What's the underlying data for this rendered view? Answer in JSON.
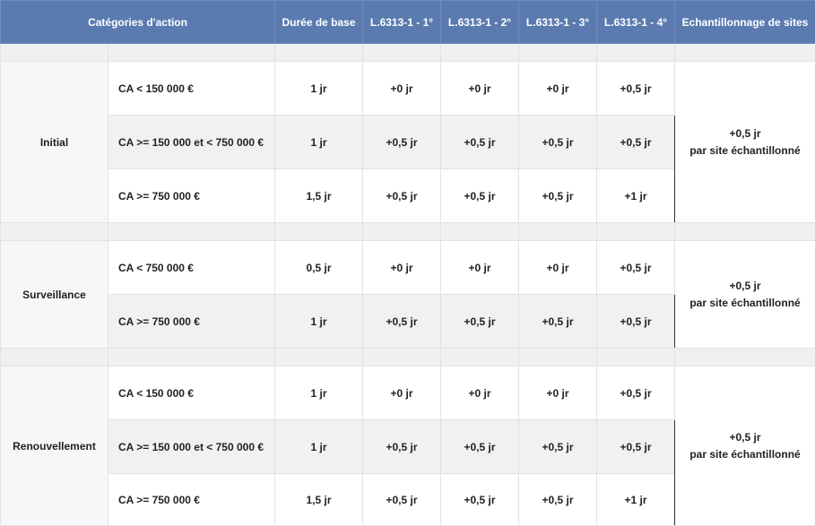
{
  "header": {
    "cols": [
      "Catégories d'action",
      "Durée de base",
      "L.6313-1 - 1°",
      "L.6313-1 - 2°",
      "L.6313-1 - 3°",
      "L.6313-1 - 4°",
      "Echantillonnage de sites"
    ]
  },
  "colors": {
    "header_bg": "#5b7bb0",
    "header_text": "#ffffff",
    "alt_row_bg": "#f1f1f1",
    "spacer_bg": "#f0f0f0"
  },
  "groups": [
    {
      "category": "Initial",
      "rows": [
        {
          "range": "CA < 150 000 €",
          "base": "1 jr",
          "c1": "+0 jr",
          "c2": "+0 jr",
          "c3": "+0 jr",
          "c4": "+0,5 jr"
        },
        {
          "range": "CA >= 150 000 et < 750 000 €",
          "base": "1 jr",
          "c1": "+0,5 jr",
          "c2": "+0,5 jr",
          "c3": "+0,5 jr",
          "c4": "+0,5 jr"
        },
        {
          "range": "CA >= 750 000 €",
          "base": "1,5 jr",
          "c1": "+0,5 jr",
          "c2": "+0,5 jr",
          "c3": "+0,5 jr",
          "c4": "+1 jr"
        }
      ],
      "sites_line1": "+0,5 jr",
      "sites_line2": "par site échantillonné"
    },
    {
      "category": "Surveillance",
      "rows": [
        {
          "range": "CA < 750 000 €",
          "base": "0,5 jr",
          "c1": "+0 jr",
          "c2": "+0 jr",
          "c3": "+0 jr",
          "c4": "+0,5 jr"
        },
        {
          "range": "CA >= 750 000 €",
          "base": "1 jr",
          "c1": "+0,5 jr",
          "c2": "+0,5 jr",
          "c3": "+0,5 jr",
          "c4": "+0,5 jr"
        }
      ],
      "sites_line1": "+0,5 jr",
      "sites_line2": "par site échantillonné"
    },
    {
      "category": "Renouvellement",
      "rows": [
        {
          "range": "CA < 150 000 €",
          "base": "1 jr",
          "c1": "+0 jr",
          "c2": "+0 jr",
          "c3": "+0 jr",
          "c4": "+0,5 jr"
        },
        {
          "range": "CA >= 150 000 et < 750 000 €",
          "base": "1 jr",
          "c1": "+0,5 jr",
          "c2": "+0,5 jr",
          "c3": "+0,5 jr",
          "c4": "+0,5 jr"
        },
        {
          "range": "CA >= 750 000 €",
          "base": "1,5 jr",
          "c1": "+0,5 jr",
          "c2": "+0,5 jr",
          "c3": "+0,5 jr",
          "c4": "+1 jr"
        }
      ],
      "sites_line1": "+0,5 jr",
      "sites_line2": "par site échantillonné"
    }
  ]
}
